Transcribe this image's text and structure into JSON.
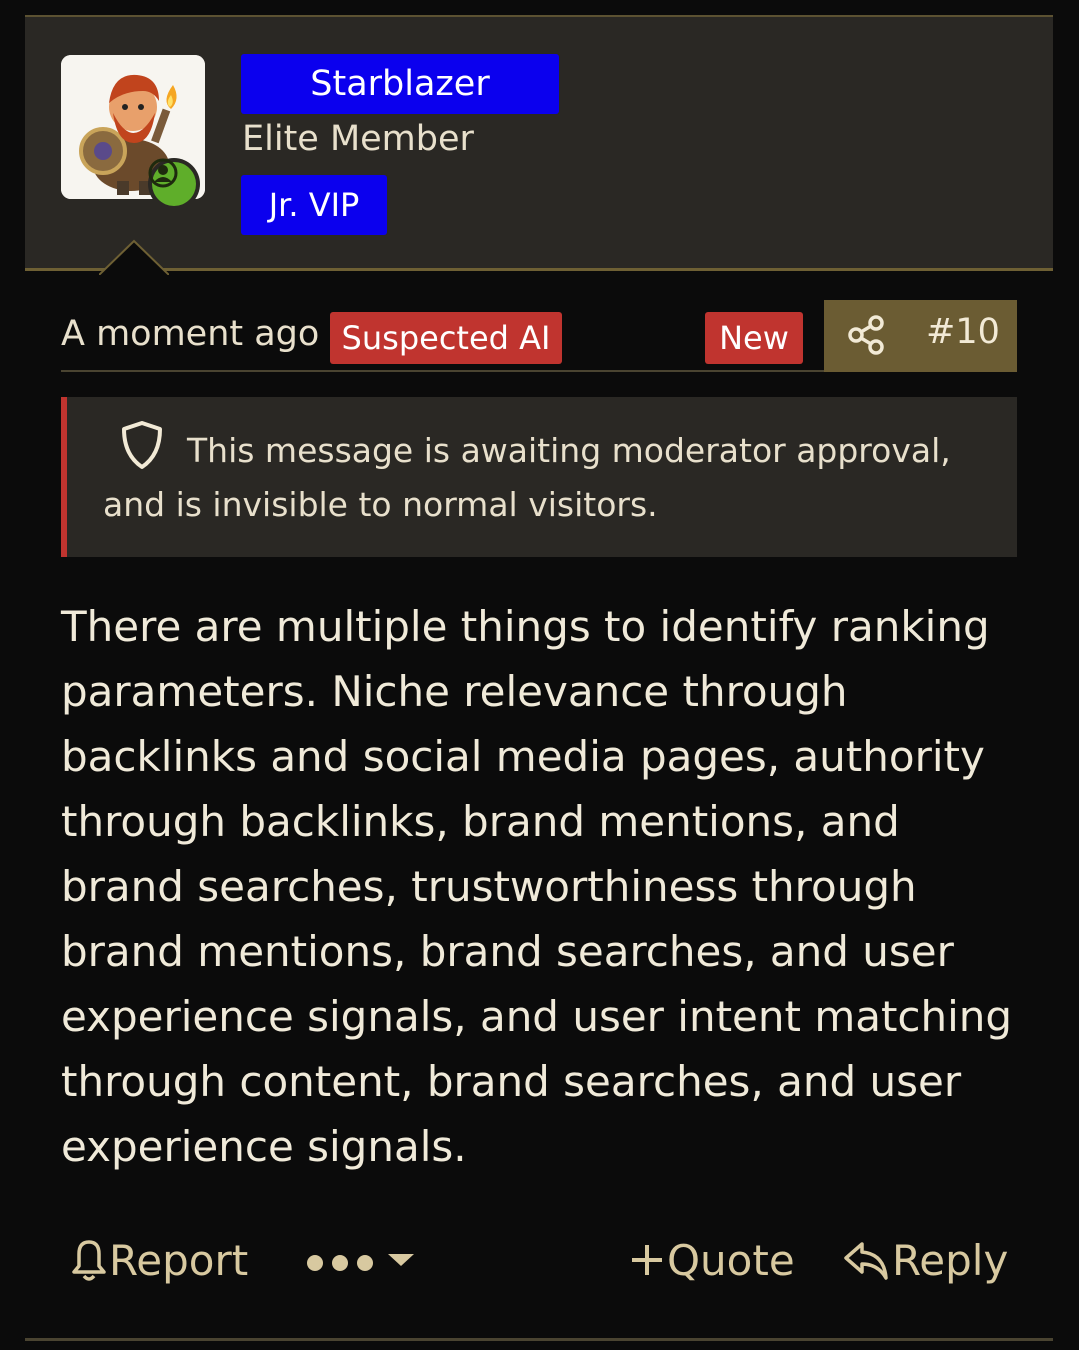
{
  "user": {
    "username": "Starblazer",
    "title": "Elite Member",
    "vip_label": "Jr. VIP",
    "badge_color": "#0b00ee",
    "online_color": "#5fae2a",
    "avatar_icon": "dwarf-character-avatar"
  },
  "post": {
    "timestamp": "A moment ago",
    "ai_badge": "Suspected AI",
    "new_badge": "New",
    "number": "#10",
    "badge_color": "#c0342f",
    "accent_color": "#6b5c33"
  },
  "notice": {
    "text": "This message is awaiting moderator approval, and is invisible to normal visitors."
  },
  "message": {
    "body": "There are multiple things to identify ranking parameters. Niche relevance through backlinks and social media pages, authority through backlinks, brand mentions, and brand searches, trustworthiness through brand mentions, brand searches, and user experience signals, and user intent matching through content, brand searches, and user experience signals."
  },
  "footer": {
    "report_label": "Report",
    "quote_label": "Quote",
    "reply_label": "Reply"
  }
}
